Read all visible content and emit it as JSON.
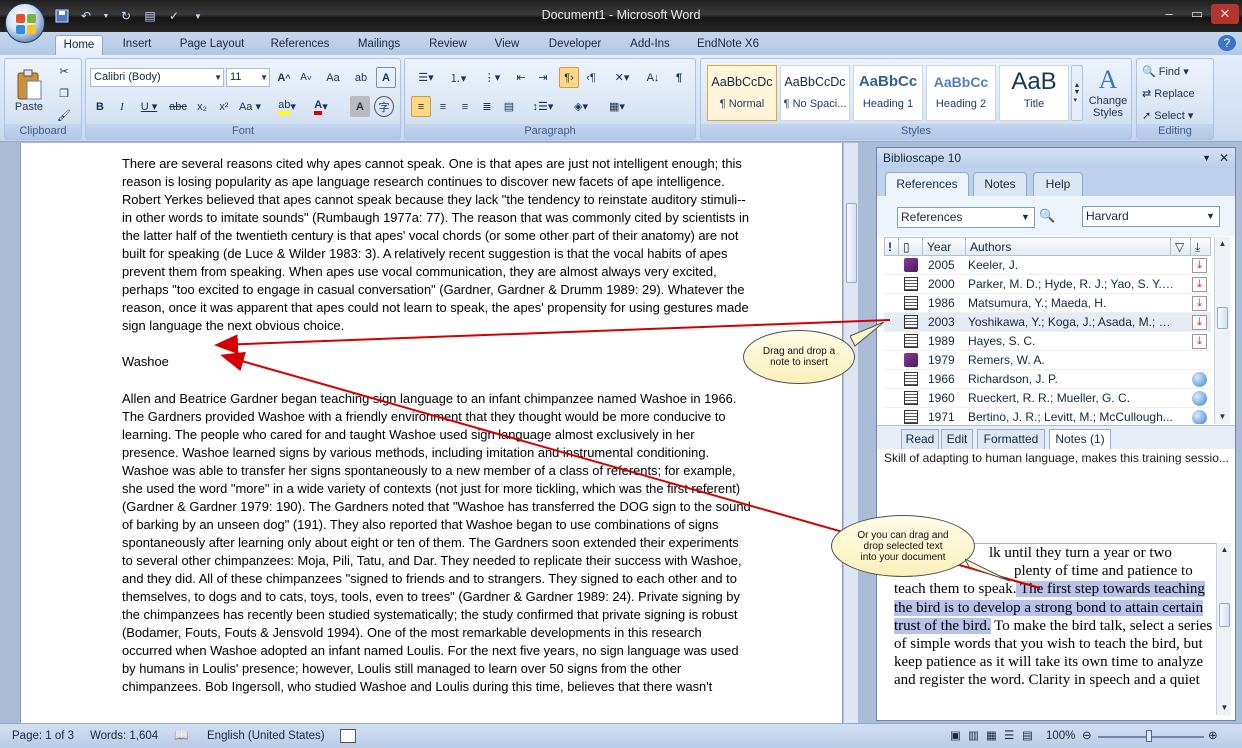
{
  "window": {
    "title": "Document1 - Microsoft Word",
    "minimize_icon": "minimize-icon",
    "maximize_icon": "maximize-icon",
    "close_icon": "close-icon"
  },
  "quick_access": [
    "save-icon",
    "undo-icon",
    "redo-icon",
    "print-preview-icon",
    "spelling-icon",
    "customize-icon"
  ],
  "ribbon_tabs": [
    "Home",
    "Insert",
    "Page Layout",
    "References",
    "Mailings",
    "Review",
    "View",
    "Developer",
    "Add-Ins",
    "EndNote X6"
  ],
  "active_tab": "Home",
  "clipboard": {
    "paste_label": "Paste",
    "group_label": "Clipboard"
  },
  "font": {
    "name": "Calibri (Body)",
    "size": "11",
    "group_label": "Font"
  },
  "paragraph": {
    "group_label": "Paragraph"
  },
  "styles": {
    "group_label": "Styles",
    "items": [
      {
        "preview": "AaBbCcDc",
        "name": "¶ Normal"
      },
      {
        "preview": "AaBbCcDc",
        "name": "¶ No Spaci..."
      },
      {
        "preview": "AaBbCc",
        "name": "Heading 1"
      },
      {
        "preview": "AaBbCc",
        "name": "Heading 2"
      },
      {
        "preview": "AaB",
        "name": "Title"
      }
    ],
    "change_styles_label": "Change Styles"
  },
  "editing": {
    "group_label": "Editing",
    "find": "Find",
    "replace": "Replace",
    "select": "Select"
  },
  "document": {
    "p1": "There are several reasons cited why apes cannot speak. One is that apes are just not intelligent enough; this reason is losing popularity as ape language research continues to discover new facets of ape intelligence. Robert Yerkes believed that apes cannot speak because they lack \"the tendency to reinstate auditory stimuli--in other words to imitate sounds\" (Rumbaugh 1977a: 77). The reason that was commonly cited by scientists in the latter half of the twentieth century is that apes' vocal chords (or some other part of their anatomy) are not built for speaking (de Luce & Wilder 1983: 3). A relatively recent suggestion is that the vocal habits of apes prevent them from speaking. When apes use vocal communication, they are almost always very excited, perhaps \"too excited to engage in casual conversation\" (Gardner, Gardner & Drumm 1989: 29). Whatever the reason, once it was apparent that apes could not learn to speak, the apes' propensity for using gestures made sign language the next obvious choice.",
    "heading": "Washoe",
    "p2": "Allen and Beatrice Gardner began teaching sign language to an infant chimpanzee named Washoe in 1966. The Gardners provided Washoe with a friendly environment that they thought would be more conducive to learning. The people who cared for and taught Washoe used sign language almost exclusively in her presence. Washoe learned signs by various methods, including imitation and instrumental conditioning. Washoe was able to transfer her signs spontaneously to a new member of a class of referents; for example, she used the word \"more\" in a wide variety of contexts (not just for more tickling, which was the first referent) (Gardner & Gardner 1979: 190). The Gardners noted that \"Washoe has transferred the DOG sign to the sound of barking by an unseen dog\" (191). They also reported that Washoe began to use combinations of signs spontaneously after learning only about eight or ten of them. The Gardners soon extended their experiments to several other chimpanzees: Moja, Pili, Tatu, and Dar. They needed to replicate their success with Washoe, and they did. All of these chimpanzees \"signed to friends and to strangers. They signed to each other and to themselves, to dogs and to cats, toys, tools, even to trees\" (Gardner & Gardner 1989: 24). Private signing by the chimpanzees has recently been studied systematically; the study confirmed that private signing is robust (Bodamer, Fouts, Fouts & Jensvold 1994). One of the most remarkable developments in this research occurred when Washoe adopted an infant named Loulis. For the next five years, no sign language was used by humans in Loulis' presence; however, Loulis still managed to learn over 50 signs from the other chimpanzees. Bob Ingersoll, who studied Washoe and Loulis during this time, believes that there wasn't"
  },
  "panel": {
    "title": "Biblioscape 10",
    "tabs": [
      "References",
      "Notes",
      "Help"
    ],
    "active_tab": "References",
    "folder": "References",
    "style": "Harvard",
    "columns": {
      "year": "Year",
      "authors": "Authors"
    },
    "rows": [
      {
        "icon": "book-icon",
        "year": "2005",
        "authors": "Keeler, J.",
        "attach": "pdf-icon"
      },
      {
        "icon": "article-icon",
        "year": "2000",
        "authors": "Parker, M. D.; Hyde, R. J.; Yao, S. Y.; ...",
        "attach": "pdf-icon"
      },
      {
        "icon": "article-icon",
        "year": "1986",
        "authors": "Matsumura, Y.; Maeda, H.",
        "attach": "pdf-icon"
      },
      {
        "icon": "article-icon",
        "year": "2003",
        "authors": "Yoshikawa, Y.; Koga, J.; Asada, M.; H...",
        "attach": "pdf-icon"
      },
      {
        "icon": "article-icon",
        "year": "1989",
        "authors": "Hayes, S. C.",
        "attach": "pdf-icon"
      },
      {
        "icon": "book-icon",
        "year": "1979",
        "authors": "Remers, W. A.",
        "attach": ""
      },
      {
        "icon": "article-icon",
        "year": "1966",
        "authors": "Richardson, J. P.",
        "attach": "globe-icon"
      },
      {
        "icon": "article-icon",
        "year": "1960",
        "authors": "Rueckert, R. R.; Mueller, G. C.",
        "attach": "globe-icon"
      },
      {
        "icon": "article-icon",
        "year": "1971",
        "authors": "Bertino, J. R.; Levitt, M.; McCullough...",
        "attach": "globe-icon"
      }
    ],
    "selected_row": 3,
    "note_tabs": [
      "Read",
      "Edit",
      "Formatted",
      "Notes (1)"
    ],
    "active_note_tab": "Notes (1)",
    "note_line": "Skill of adapting to human language, makes this training sessio...",
    "text_pre": "...lk until they turn a year or two ...plenty of time and patience to teach them to speak.",
    "text_line1": "lk until they turn a year or two",
    "text_line2": "plenty of time and patience to",
    "text_line3a": "teach them to speak.",
    "text_hl": " The first step towards teaching the bird is to develop a strong bond to attain certain trust of the bird.",
    "text_post": " To make the bird talk, select a series of simple words that you wish to teach the bird, but keep patience as it will take its own time to analyze and register the word. Clarity in speech and a quiet"
  },
  "callouts": {
    "one": "Drag and drop a note to insert",
    "two": "Or you can drag and drop selected text into your document"
  },
  "status": {
    "page": "Page: 1 of 3",
    "words": "Words: 1,604",
    "language": "English (United States)",
    "zoom": "100%"
  },
  "colors": {
    "arrow": "#d40000",
    "accent": "#2b579a",
    "highlight": "#b9c3ea"
  }
}
